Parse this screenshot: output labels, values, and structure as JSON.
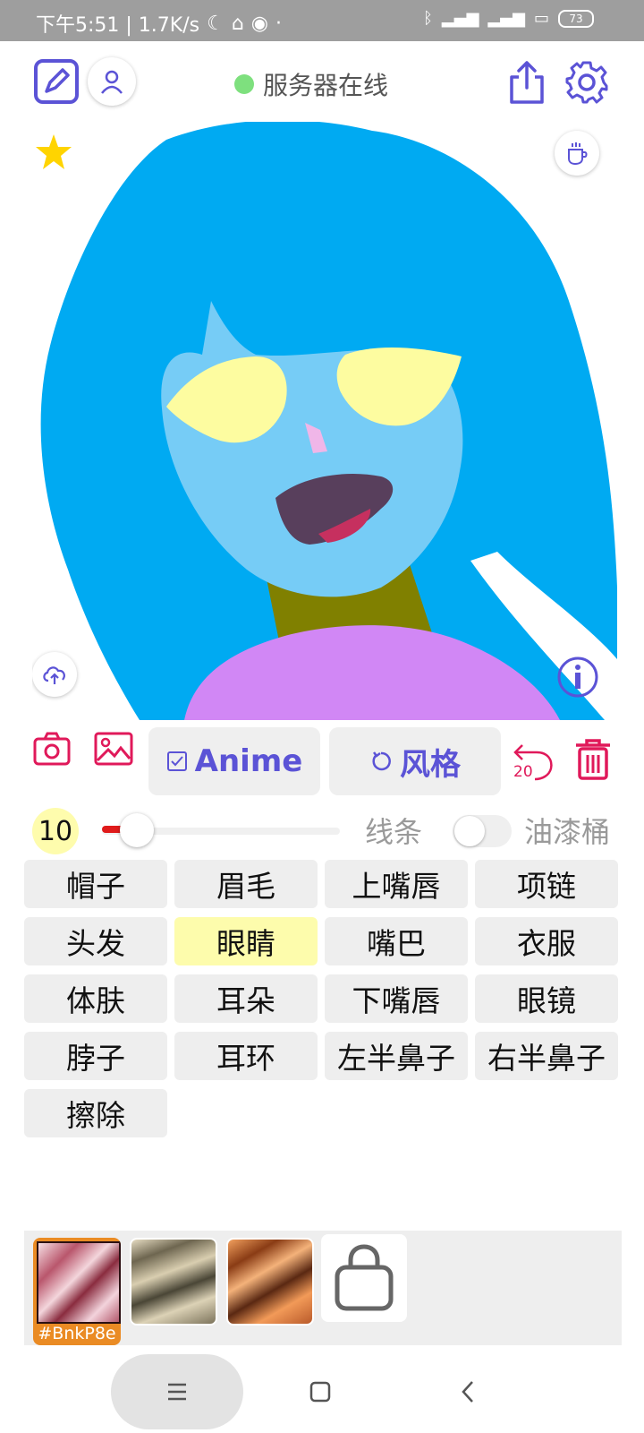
{
  "status_bar": {
    "left_text": "下午5:51 | 1.7K/s",
    "battery": "73"
  },
  "header": {
    "server_status": "服务器在线",
    "server_status_color": "#7ee07e",
    "icons": [
      "edit-icon",
      "user-icon",
      "share-icon",
      "gear-icon"
    ]
  },
  "canvas": {
    "icons": [
      "star-icon",
      "coffee-icon",
      "cloud-upload-icon",
      "info-icon"
    ]
  },
  "toolbar": {
    "anime_label": "Anime",
    "style_label": "风格",
    "undo_count": "20",
    "icons": [
      "camera-icon",
      "image-icon",
      "checkbox-icon",
      "refresh-icon",
      "undo-icon",
      "trash-icon"
    ],
    "accent_color": "#5b53d6",
    "danger_color": "#e0195a"
  },
  "brush": {
    "size": "10",
    "slider_value": 10,
    "line_label": "线条",
    "bucket_label": "油漆桶",
    "bucket_enabled": false
  },
  "parts": [
    {
      "label": "帽子",
      "selected": false
    },
    {
      "label": "眉毛",
      "selected": false
    },
    {
      "label": "上嘴唇",
      "selected": false
    },
    {
      "label": "项链",
      "selected": false
    },
    {
      "label": "头发",
      "selected": false
    },
    {
      "label": "眼睛",
      "selected": true
    },
    {
      "label": "嘴巴",
      "selected": false
    },
    {
      "label": "衣服",
      "selected": false
    },
    {
      "label": "体肤",
      "selected": false
    },
    {
      "label": "耳朵",
      "selected": false
    },
    {
      "label": "下嘴唇",
      "selected": false
    },
    {
      "label": "眼镜",
      "selected": false
    },
    {
      "label": "脖子",
      "selected": false
    },
    {
      "label": "耳环",
      "selected": false
    },
    {
      "label": "左半鼻子",
      "selected": false
    },
    {
      "label": "右半鼻子",
      "selected": false
    },
    {
      "label": "擦除",
      "selected": false
    }
  ],
  "textures": {
    "selected_code": "#BnkP8e",
    "items": [
      "texture-pink",
      "texture-beige",
      "texture-orange"
    ],
    "shop_icon": "bag-icon"
  },
  "nav": {
    "icons": [
      "menu-icon",
      "home-icon",
      "back-icon"
    ]
  }
}
